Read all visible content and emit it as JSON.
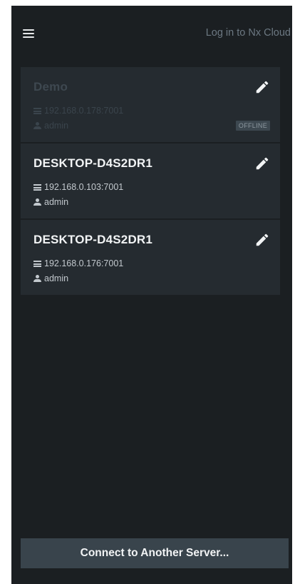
{
  "header": {
    "cloud_link": "Log in to Nx Cloud",
    "menu_icon": "hamburger-menu-icon"
  },
  "servers": [
    {
      "name": "Demo",
      "address": "192.168.0.178:7001",
      "user": "admin",
      "status": "OFFLINE"
    },
    {
      "name": "DESKTOP-D4S2DR1",
      "address": "192.168.0.103:7001",
      "user": "admin"
    },
    {
      "name": "DESKTOP-D4S2DR1",
      "address": "192.168.0.176:7001",
      "user": "admin"
    }
  ],
  "footer": {
    "connect_label": "Connect to Another Server..."
  },
  "colors": {
    "background": "#1b1f22",
    "card": "#252b30",
    "button": "#39444c",
    "muted_text": "#6c7882"
  }
}
